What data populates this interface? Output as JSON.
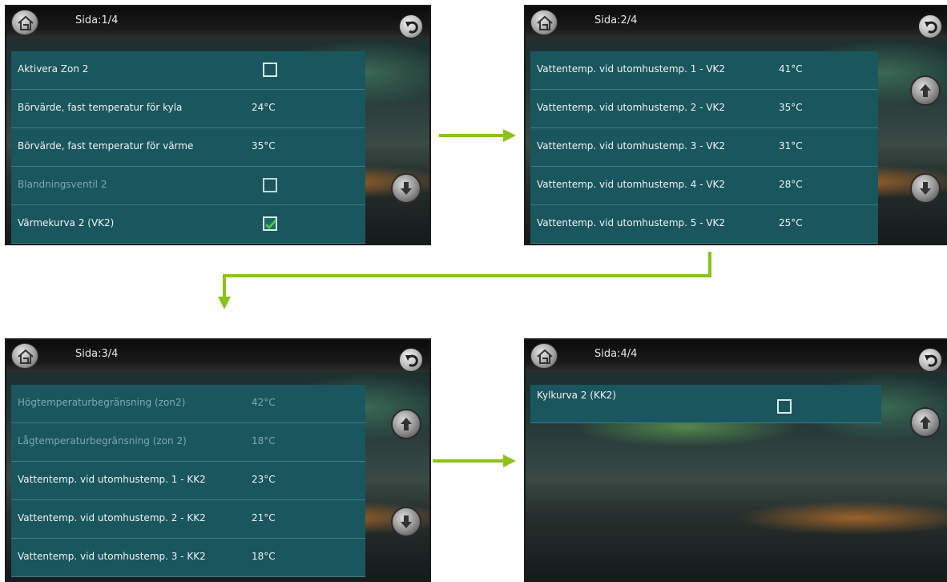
{
  "screens": [
    {
      "title": "Sida:1/4",
      "rows": [
        {
          "label": "Aktivera Zon 2",
          "type": "checkbox",
          "checked": false,
          "dim": false
        },
        {
          "label": "Börvärde, fast temperatur för kyla",
          "type": "value",
          "value": "24°C",
          "dim": false
        },
        {
          "label": "Börvärde, fast temperatur för värme",
          "type": "value",
          "value": "35°C",
          "dim": false
        },
        {
          "label": "Blandningsventil 2",
          "type": "checkbox",
          "checked": false,
          "dim": true
        },
        {
          "label": "Värmekurva 2 (VK2)",
          "type": "checkbox",
          "checked": true,
          "dim": false
        }
      ]
    },
    {
      "title": "Sida:2/4",
      "rows": [
        {
          "label": "Vattentemp. vid utomhustemp. 1 - VK2",
          "value": "41°C"
        },
        {
          "label": "Vattentemp. vid utomhustemp. 2 - VK2",
          "value": "35°C"
        },
        {
          "label": "Vattentemp. vid utomhustemp. 3 - VK2",
          "value": "31°C"
        },
        {
          "label": "Vattentemp. vid utomhustemp. 4 - VK2",
          "value": "28°C"
        },
        {
          "label": "Vattentemp. vid utomhustemp. 5 - VK2",
          "value": "25°C"
        }
      ]
    },
    {
      "title": "Sida:3/4",
      "rows": [
        {
          "label": "Högtemperaturbegränsning (zon2)",
          "value": "42°C",
          "dim": true
        },
        {
          "label": "Lågtemperaturbegränsning (zon 2)",
          "value": "18°C",
          "dim": true
        },
        {
          "label": "Vattentemp. vid utomhustemp. 1 - KK2",
          "value": "23°C"
        },
        {
          "label": "Vattentemp. vid utomhustemp. 2 - KK2",
          "value": "21°C"
        },
        {
          "label": "Vattentemp. vid utomhustemp. 3 - KK2",
          "value": "18°C"
        }
      ]
    },
    {
      "title": "Sida:4/4",
      "rows": [
        {
          "label": "Kylkurva 2 (KK2)",
          "type": "checkbox",
          "checked": false
        }
      ]
    }
  ],
  "icons": {
    "home": "home-icon",
    "back": "back-arrow-icon",
    "up": "up-arrow-icon",
    "down": "down-arrow-icon",
    "check": "checkmark-icon"
  },
  "colors": {
    "row_bg": "#19565e",
    "flow_arrow": "#8cc21b",
    "check_mark": "#4cc44c"
  }
}
